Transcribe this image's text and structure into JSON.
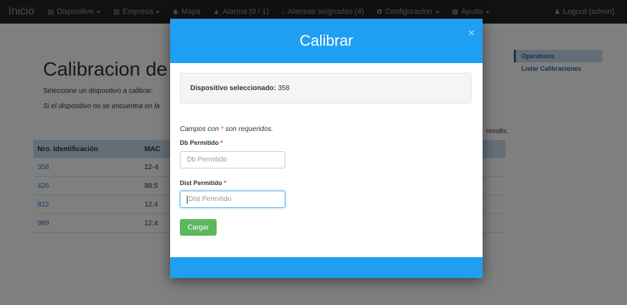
{
  "navbar": {
    "brand": "Inicio",
    "items": [
      {
        "icon": "device-icon",
        "glyph": "▤",
        "label": "Dispositivo",
        "caret": true
      },
      {
        "icon": "building-icon",
        "glyph": "▥",
        "label": "Empresa",
        "caret": true
      },
      {
        "icon": "globe-icon",
        "glyph": "◉",
        "label": "Mapa",
        "caret": false
      },
      {
        "icon": "bell-icon",
        "glyph": "▲",
        "label": "Alarma (0 / 1)",
        "caret": false
      },
      {
        "icon": "download-icon",
        "glyph": "↓",
        "label": "Alarmas asignadas (4)",
        "caret": false
      },
      {
        "icon": "gear-icon",
        "glyph": "✿",
        "label": "Configuracion",
        "caret": true
      },
      {
        "icon": "help-icon",
        "glyph": "▦",
        "label": "Ayuda",
        "caret": true
      }
    ],
    "logout": {
      "icon": "user-icon",
      "glyph": "♟",
      "label": "Logout (admin)"
    }
  },
  "page": {
    "title": "Calibracion de",
    "subtitle": "Seleccione un dispositivo a calibrar.",
    "note": "Si el dispositivo no se encuentra en la",
    "results": "results."
  },
  "table": {
    "headers": [
      "Nro. Identificación",
      "MAC"
    ],
    "rows": [
      {
        "id": "358",
        "mac": "12-4"
      },
      {
        "id": "426",
        "mac": "88:5"
      },
      {
        "id": "822",
        "mac": "12:4"
      },
      {
        "id": "989",
        "mac": "12:4"
      }
    ]
  },
  "sidebar": {
    "heading": "Operations",
    "items": [
      "Listar Calibraciones"
    ]
  },
  "modal": {
    "title": "Calibrar",
    "close": "×",
    "selected_label": "Dispositivo seleccionado:",
    "selected_value": "358",
    "required_note_before": "Campos con ",
    "required_star": "*",
    "required_note_after": " son requeridos.",
    "fields": [
      {
        "label": "Db Permitido",
        "placeholder": "Db Permitido"
      },
      {
        "label": "Dist Permitido",
        "placeholder": "Dist Permitido"
      }
    ],
    "submit": "Cargar"
  },
  "colors": {
    "modal_header": "#1e9ff2",
    "submit_button": "#5cb85c",
    "table_header": "#c7dcf3",
    "navbar": "#222222"
  }
}
